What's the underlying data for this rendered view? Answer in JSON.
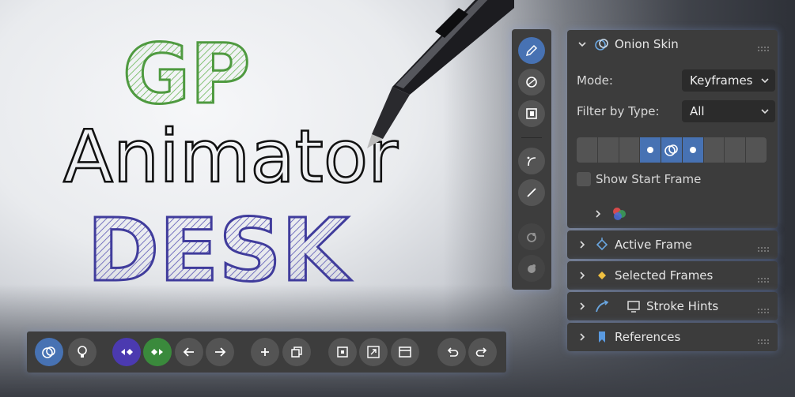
{
  "title_art": {
    "line1": "GP",
    "line2": "Animator",
    "line3": "DESK",
    "colors": {
      "gp": "#5aa84a",
      "animator": "#111111",
      "desk": "#4b47a6"
    }
  },
  "toolstrip": {
    "tools": [
      {
        "name": "draw",
        "icon": "pencil-icon",
        "active": true
      },
      {
        "name": "erase",
        "icon": "eraser-icon"
      },
      {
        "name": "fill",
        "icon": "fill-icon"
      },
      {
        "name": "curve",
        "icon": "curve-icon"
      },
      {
        "name": "line",
        "icon": "line-icon"
      },
      {
        "name": "sculpt-a",
        "icon": "sculpt-icon",
        "dim": true
      },
      {
        "name": "sculpt-b",
        "icon": "sculpt-icon",
        "dim": true
      }
    ]
  },
  "onion_skin": {
    "title": "Onion Skin",
    "mode_label": "Mode:",
    "mode_value": "Keyframes",
    "filter_label": "Filter by Type:",
    "filter_value": "All",
    "frames_total": 9,
    "frames_active": [
      3,
      4,
      5
    ],
    "show_start_frame_label": "Show Start Frame",
    "show_start_frame": false
  },
  "panels": {
    "active_frame": "Active Frame",
    "selected_frames": "Selected Frames",
    "stroke_hints": "Stroke Hints",
    "references": "References"
  },
  "bottom_toolbar": {
    "buttons": [
      "onion-skin-toggle-icon",
      "lightbulb-icon",
      "prev-keyframe-icon",
      "next-keyframe-icon",
      "arrow-left-icon",
      "arrow-right-icon",
      "add-icon",
      "duplicate-icon",
      "stop-icon",
      "fullscreen-icon",
      "window-icon",
      "undo-icon",
      "redo-icon"
    ]
  },
  "accent": "#4772b3"
}
